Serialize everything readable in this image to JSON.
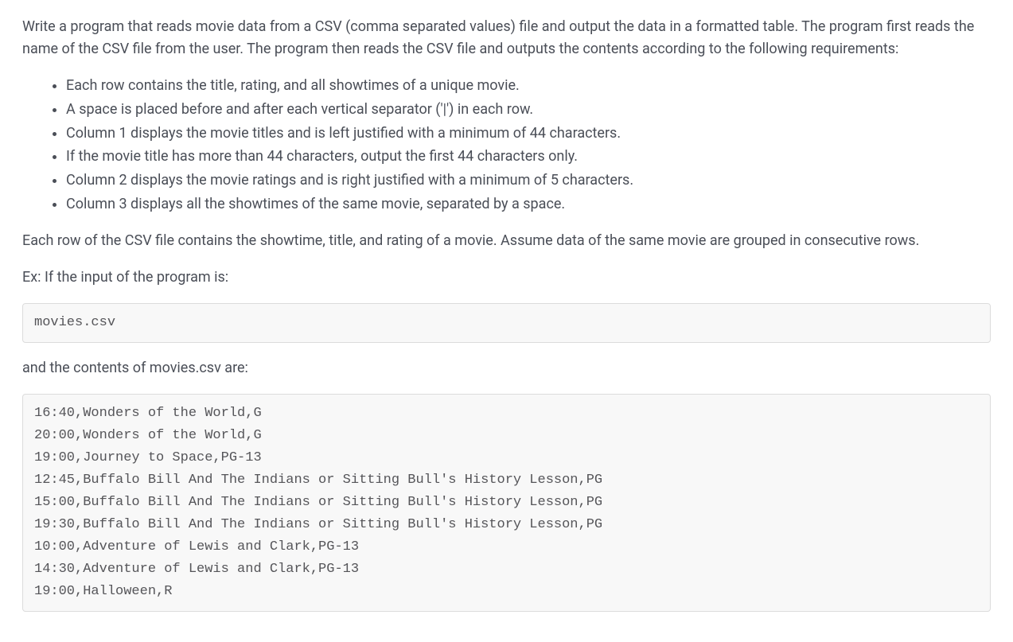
{
  "intro_paragraph": "Write a program that reads movie data from a CSV (comma separated values) file and output the data in a formatted table. The program first reads the name of the CSV file from the user. The program then reads the CSV file and outputs the contents according to the following requirements:",
  "requirements": [
    "Each row contains the title, rating, and all showtimes of a unique movie.",
    "A space is placed before and after each vertical separator ('|') in each row.",
    "Column 1 displays the movie titles and is left justified with a minimum of 44 characters.",
    "If the movie title has more than 44 characters, output the first 44 characters only.",
    "Column 2 displays the movie ratings and is right justified with a minimum of 5 characters.",
    "Column 3 displays all the showtimes of the same movie, separated by a space."
  ],
  "csv_row_description": "Each row of the CSV file contains the showtime, title, and rating of a movie. Assume data of the same movie are grouped in consecutive rows.",
  "example_input_label": "Ex: If the input of the program is:",
  "example_input_code": "movies.csv",
  "csv_contents_label": "and the contents of movies.csv are:",
  "csv_contents_code": "16:40,Wonders of the World,G\n20:00,Wonders of the World,G\n19:00,Journey to Space,PG-13\n12:45,Buffalo Bill And The Indians or Sitting Bull's History Lesson,PG\n15:00,Buffalo Bill And The Indians or Sitting Bull's History Lesson,PG\n19:30,Buffalo Bill And The Indians or Sitting Bull's History Lesson,PG\n10:00,Adventure of Lewis and Clark,PG-13\n14:30,Adventure of Lewis and Clark,PG-13\n19:00,Halloween,R"
}
